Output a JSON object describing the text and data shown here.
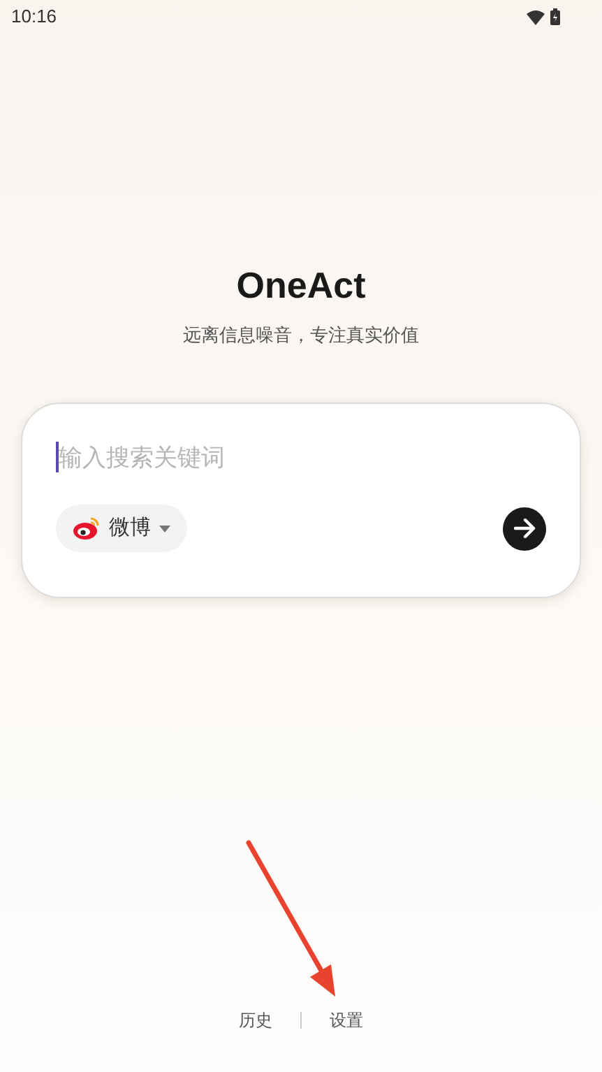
{
  "status_bar": {
    "time": "10:16"
  },
  "app": {
    "title": "OneAct",
    "tagline": "远离信息噪音，专注真实价值"
  },
  "search": {
    "placeholder": "输入搜索关键词",
    "source": "微博"
  },
  "footer_links": [
    {
      "label": "历史"
    },
    {
      "label": "设置"
    }
  ]
}
